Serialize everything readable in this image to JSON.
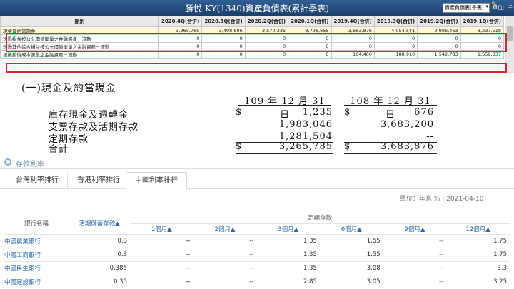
{
  "window": {
    "title": "勝悅-KY(1340)資產負債表(累計季表)",
    "report_type": "資產負債表(季表)",
    "unit_label": "單位：千"
  },
  "balance_sheet": {
    "period_header": "期別",
    "columns": [
      "2020.4Q(合併)",
      "2020.3Q(合併)",
      "2020.2Q(合併)",
      "2020.1Q(合併)",
      "2019.4Q(合併)",
      "2019.3Q(合併)",
      "2019.2Q(合併)",
      "2019.1Q(合併)"
    ],
    "rows": [
      {
        "label": "現金及約當現金",
        "values": [
          "3,265,785",
          "3,498,886",
          "3,570,235",
          "3,796,555",
          "3,683,876",
          "4,054,541",
          "2,986,463",
          "3,237,518"
        ]
      },
      {
        "label": "透過損益按公允價值衡量之金融資產－流動",
        "values": [
          "0",
          "0",
          "0",
          "0",
          "0",
          "0",
          "0",
          "0"
        ]
      },
      {
        "label": "透過其他綜合損益按公允價值衡量之金融資產－流動",
        "values": [
          "0",
          "0",
          "0",
          "0",
          "0",
          "0",
          "0",
          "0"
        ]
      },
      {
        "label": "按攤銷後成本衡量之金融資產－流動",
        "values": [
          "0",
          "0",
          "0",
          "0",
          "184,400",
          "188,910",
          "1,542,783",
          "1,559,037"
        ]
      }
    ]
  },
  "cash_note": {
    "heading": "(一)現金及約當現金",
    "date_1": "109 年 12 月 31 日",
    "date_2": "108 年 12 月 31 日",
    "currency": "$",
    "rows": [
      {
        "label": "庫存現金及週轉金",
        "v1": "1,235",
        "v2": "676"
      },
      {
        "label": "支票存款及活期存款",
        "v1": "1,983,046",
        "v2": "3,683,200"
      },
      {
        "label": "定期存款",
        "v1": "1,281,504",
        "v2": "--"
      },
      {
        "label": "合計",
        "v1": "3,265,785",
        "v2": "3,683,876"
      }
    ]
  },
  "rates": {
    "section_title": "存款利率",
    "tabs": [
      "台灣利率排行",
      "香港利率排行",
      "中國利率排行"
    ],
    "active_tab": 2,
    "unit_date": "單位：年息 %  |  2021-04-10",
    "header": {
      "bank_name": "銀行名稱",
      "demand": "活期儲蓄存款▲",
      "time_deposit": "定期存款",
      "terms": [
        "1個月▲",
        "2個月▲",
        "3個月▲",
        "6個月▲",
        "9個月▲",
        "12個月▲"
      ]
    },
    "banks": [
      {
        "name": "中國農業銀行",
        "values": [
          "0.3",
          "--",
          "--",
          "1.35",
          "1.55",
          "--",
          "1.75"
        ]
      },
      {
        "name": "中國工商銀行",
        "values": [
          "0.3",
          "--",
          "--",
          "1.35",
          "1.55",
          "--",
          "1.75"
        ]
      },
      {
        "name": "中國民生銀行",
        "values": [
          "0.385",
          "--",
          "--",
          "1.35",
          "3.08",
          "--",
          "3.3"
        ]
      },
      {
        "name": "中國建設銀行",
        "values": [
          "0.35",
          "--",
          "--",
          "2.85",
          "3.05",
          "--",
          "3.25"
        ]
      }
    ]
  }
}
